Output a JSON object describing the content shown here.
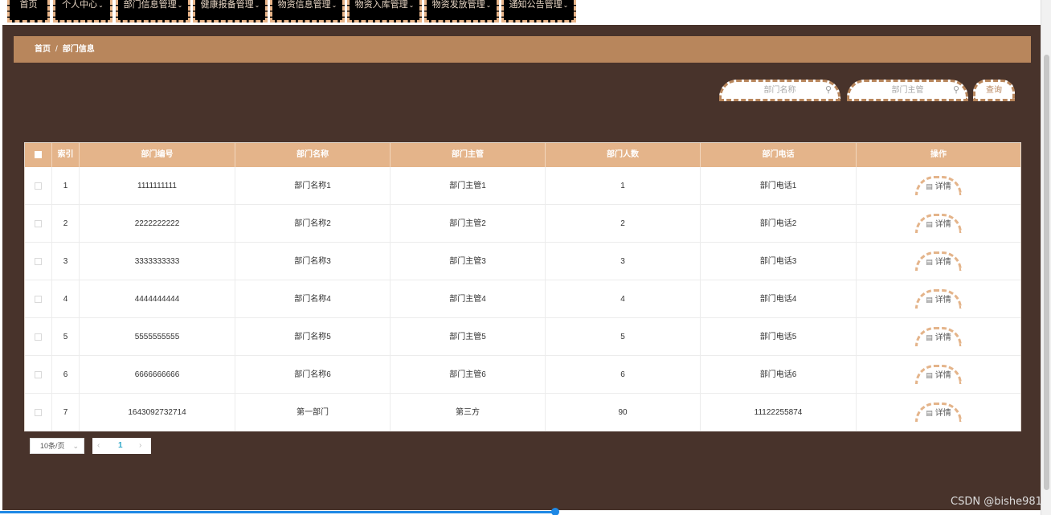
{
  "nav": {
    "items": [
      {
        "label": "首页",
        "has_caret": false
      },
      {
        "label": "个人中心",
        "has_caret": true
      },
      {
        "label": "部门信息管理",
        "has_caret": true
      },
      {
        "label": "健康报备管理",
        "has_caret": true
      },
      {
        "label": "物资信息管理",
        "has_caret": true
      },
      {
        "label": "物资入库管理",
        "has_caret": true
      },
      {
        "label": "物资发放管理",
        "has_caret": true
      },
      {
        "label": "通知公告管理",
        "has_caret": true
      }
    ],
    "caret": "⌄"
  },
  "breadcrumb": {
    "home": "首页",
    "separator": "/",
    "current": "部门信息"
  },
  "search": {
    "name_placeholder": "部门名称",
    "manager_placeholder": "部门主管",
    "query_label": "查询"
  },
  "table": {
    "headers": [
      "索引",
      "部门编号",
      "部门名称",
      "部门主管",
      "部门人数",
      "部门电话",
      "操作"
    ],
    "detail_label": "详情",
    "rows": [
      {
        "index": "1",
        "code": "1111111111",
        "name": "部门名称1",
        "manager": "部门主管1",
        "count": "1",
        "phone": "部门电话1"
      },
      {
        "index": "2",
        "code": "2222222222",
        "name": "部门名称2",
        "manager": "部门主管2",
        "count": "2",
        "phone": "部门电话2"
      },
      {
        "index": "3",
        "code": "3333333333",
        "name": "部门名称3",
        "manager": "部门主管3",
        "count": "3",
        "phone": "部门电话3"
      },
      {
        "index": "4",
        "code": "4444444444",
        "name": "部门名称4",
        "manager": "部门主管4",
        "count": "4",
        "phone": "部门电话4"
      },
      {
        "index": "5",
        "code": "5555555555",
        "name": "部门名称5",
        "manager": "部门主管5",
        "count": "5",
        "phone": "部门电话5"
      },
      {
        "index": "6",
        "code": "6666666666",
        "name": "部门名称6",
        "manager": "部门主管6",
        "count": "6",
        "phone": "部门电话6"
      },
      {
        "index": "7",
        "code": "1643092732714",
        "name": "第一部门",
        "manager": "第三方",
        "count": "90",
        "phone": "11122255874"
      }
    ]
  },
  "pagination": {
    "page_size": "10条/页",
    "current_page": "1",
    "prev": "‹",
    "next": "›",
    "dropdown_arrow": "⌄"
  },
  "watermark": "CSDN @bishe981",
  "colors": {
    "background": "#48332b",
    "accent": "#b8865c",
    "header": "#e4b48a",
    "nav_bg": "#000000",
    "page_active": "#2ea7c8"
  }
}
